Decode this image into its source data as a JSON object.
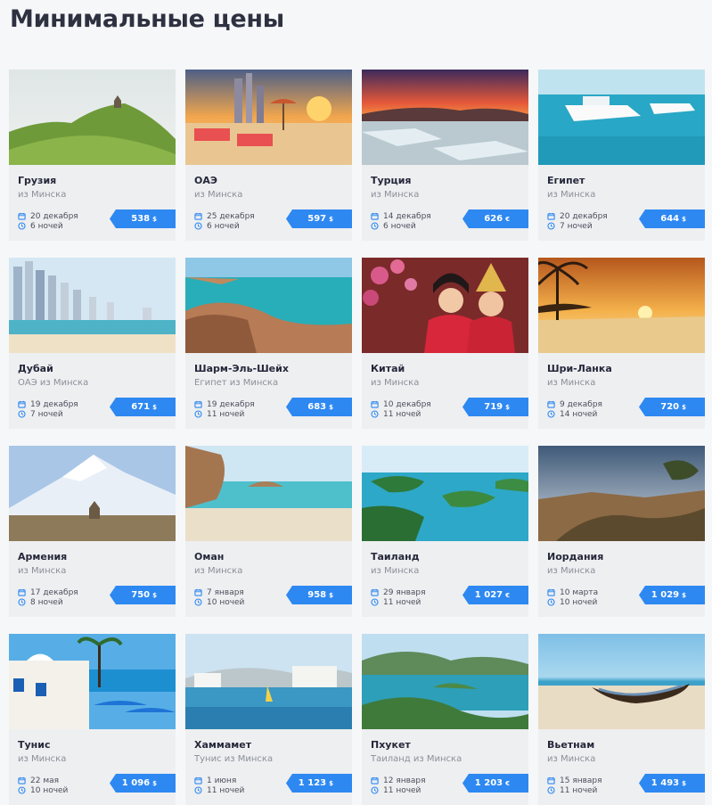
{
  "page": {
    "title": "Минимальные цены"
  },
  "cards": [
    {
      "name": "Грузия",
      "origin": "из Минска",
      "date": "20 декабря",
      "nights": "6 ночей",
      "price": "538",
      "currency": "$",
      "scene": "mountain-green",
      "image": "georgia-photo"
    },
    {
      "name": "ОАЭ",
      "origin": "из Минска",
      "date": "25 декабря",
      "nights": "6 ночей",
      "price": "597",
      "currency": "$",
      "scene": "beach-city",
      "image": "uae-photo"
    },
    {
      "name": "Турция",
      "origin": "из Минска",
      "date": "14 декабря",
      "nights": "6 ночей",
      "price": "626",
      "currency": "€",
      "scene": "sunset-terraces",
      "image": "turkey-photo"
    },
    {
      "name": "Египет",
      "origin": "из Минска",
      "date": "20 декабря",
      "nights": "7 ночей",
      "price": "644",
      "currency": "$",
      "scene": "boats-sea",
      "image": "egypt-photo"
    },
    {
      "name": "Дубай",
      "origin": "ОАЭ из Минска",
      "date": "19 декабря",
      "nights": "7 ночей",
      "price": "671",
      "currency": "$",
      "scene": "skyline-beach",
      "image": "dubai-photo"
    },
    {
      "name": "Шарм-Эль-Шейх",
      "origin": "Египет из Минска",
      "date": "19 декабря",
      "nights": "11 ночей",
      "price": "683",
      "currency": "$",
      "scene": "coast-resort",
      "image": "sharm-photo"
    },
    {
      "name": "Китай",
      "origin": "из Минска",
      "date": "10 декабря",
      "nights": "11 ночей",
      "price": "719",
      "currency": "$",
      "scene": "people-red",
      "image": "china-photo"
    },
    {
      "name": "Шри-Ланка",
      "origin": "из Минска",
      "date": "9 декабря",
      "nights": "14 ночей",
      "price": "720",
      "currency": "$",
      "scene": "palm-sunset",
      "image": "srilanka-photo"
    },
    {
      "name": "Армения",
      "origin": "из Минска",
      "date": "17 декабря",
      "nights": "8 ночей",
      "price": "750",
      "currency": "$",
      "scene": "snow-mountain",
      "image": "armenia-photo"
    },
    {
      "name": "Оман",
      "origin": "из Минска",
      "date": "7 января",
      "nights": "10 ночей",
      "price": "958",
      "currency": "$",
      "scene": "rock-beach",
      "image": "oman-photo"
    },
    {
      "name": "Таиланд",
      "origin": "из Минска",
      "date": "29 января",
      "nights": "11 ночей",
      "price": "1 027",
      "currency": "€",
      "scene": "islands",
      "image": "thailand-photo"
    },
    {
      "name": "Иордания",
      "origin": "из Минска",
      "date": "10 марта",
      "nights": "10 ночей",
      "price": "1 029",
      "currency": "$",
      "scene": "desert-canyon",
      "image": "jordan-photo"
    },
    {
      "name": "Тунис",
      "origin": "из Минска",
      "date": "22 мая",
      "nights": "10 ночей",
      "price": "1 096",
      "currency": "$",
      "scene": "white-blue-town",
      "image": "tunisia-photo"
    },
    {
      "name": "Хаммамет",
      "origin": "Тунис из Минска",
      "date": "1 июня",
      "nights": "11 ночей",
      "price": "1 123",
      "currency": "$",
      "scene": "town-shore",
      "image": "hammamet-photo"
    },
    {
      "name": "Пхукет",
      "origin": "Таиланд из Минска",
      "date": "12 января",
      "nights": "11 ночей",
      "price": "1 203",
      "currency": "€",
      "scene": "bay-hills",
      "image": "phuket-photo"
    },
    {
      "name": "Вьетнам",
      "origin": "из Минска",
      "date": "15 января",
      "nights": "11 ночей",
      "price": "1 493",
      "currency": "$",
      "scene": "boat-beach",
      "image": "vietnam-photo"
    }
  ],
  "icons": {
    "date": "calendar-icon",
    "duration": "clock-icon"
  },
  "colors": {
    "accent": "#2d88f1",
    "card_bg": "#eeeff1",
    "page_bg": "#f6f7f9",
    "title": "#2e3140"
  }
}
